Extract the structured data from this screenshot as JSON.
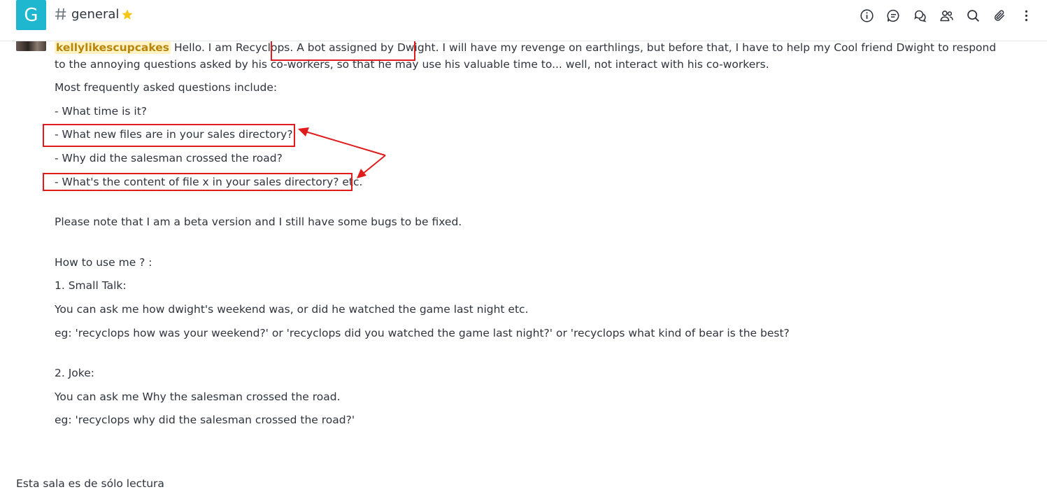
{
  "header": {
    "room_avatar_letter": "G",
    "room_name": "general",
    "toolbar_icons": [
      "info-icon",
      "discussion-icon",
      "threads-icon",
      "members-icon",
      "search-icon",
      "attachment-icon",
      "kebab-menu-icon"
    ]
  },
  "message": {
    "username": "kellylikescupcakes",
    "intro_start": "Hello. I am Recyclops.",
    "intro_highlight": "A bot assigned by Dwight.",
    "intro_rest": "I will have my revenge on earthlings, but before that, I have to help my Cool friend Dwight to respond to the annoying questions asked by his co-workers, so that he may use his valuable time to... well, not interact with his co-workers.",
    "lines": {
      "faq_title": "Most frequently asked questions include:",
      "q1": "- What time is it?",
      "q2": "- What new files are in your sales directory?",
      "q3": "- Why did the salesman crossed the road?",
      "q4": "- What's the content of file x in your sales directory? etc.",
      "beta_note": "Please note that I am a beta version and I still have some bugs to be fixed.",
      "how_to": "How to use me ? :",
      "small_talk_title": "1. Small Talk:",
      "small_talk_desc": "You can ask me how dwight's weekend was, or did he watched the game last night etc.",
      "small_talk_eg": "eg: 'recyclops how was your weekend?' or 'recyclops did you watched the game last night?' or 'recyclops what kind of bear is the best?",
      "joke_title": "2. Joke:",
      "joke_desc": "You can ask me Why the salesman crossed the road.",
      "joke_eg": "eg: 'recyclops why did the salesman crossed the road?'"
    }
  },
  "footer": {
    "readonly_text": "Esta sala es de sólo lectura"
  },
  "colors": {
    "accent": "#1fb6cf",
    "star": "#f5c518",
    "annotation": "#e01b1b",
    "username_bg": "#fff3c4"
  }
}
